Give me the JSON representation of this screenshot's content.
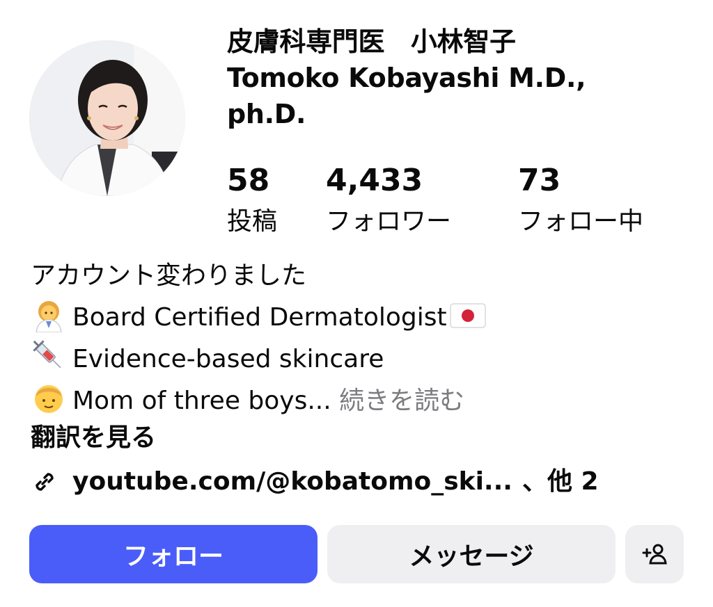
{
  "profile": {
    "name_line1": "皮膚科専門医　小林智子",
    "name_line2": "Tomoko Kobayashi M.D.,",
    "name_line3": "ph.D."
  },
  "stats": [
    {
      "value": "58",
      "label": "投稿"
    },
    {
      "value": "4,433",
      "label": "フォロワー"
    },
    {
      "value": "73",
      "label": "フォロー中"
    }
  ],
  "bio": {
    "line1": "アカウント変わりました",
    "line2_text": "Board  Certified Dermatologist",
    "line2_emoji": "health-worker-woman-icon",
    "line2_flag": "japan-flag-icon",
    "line3_text": "Evidence-based skincare",
    "line3_emoji": "syringe-icon",
    "line4_text": "Mom of three boys...",
    "line4_emoji": "boy-icon",
    "more_label": "続きを読む"
  },
  "translate_label": "翻訳を見る",
  "link": {
    "text": "youtube.com/@kobatomo_ski...",
    "suffix": "、他 2",
    "icon": "link-icon"
  },
  "buttons": {
    "follow": "フォロー",
    "message": "メッセージ",
    "add_person_icon": "add-person-icon"
  },
  "colors": {
    "follow_bg": "#4a5df9",
    "secondary_bg": "#efeff1",
    "muted_text": "#7c7c80"
  }
}
